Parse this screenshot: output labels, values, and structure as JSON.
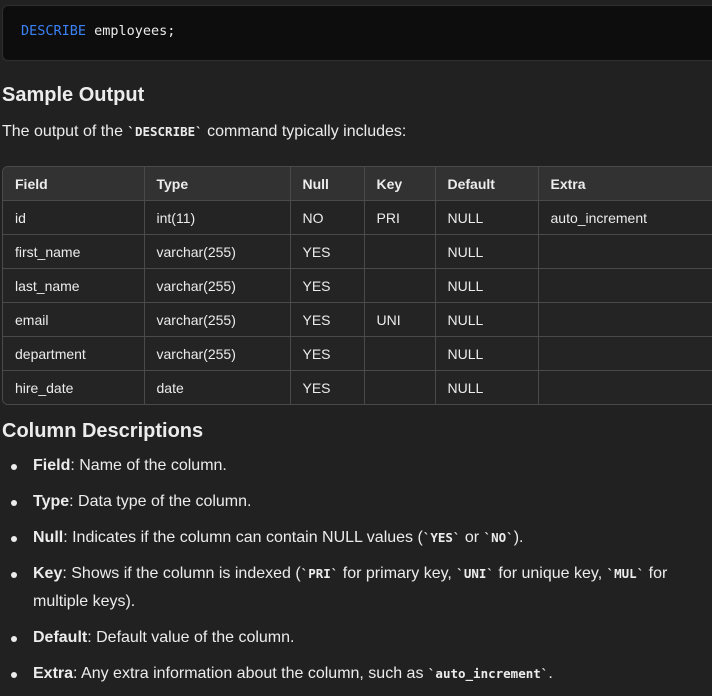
{
  "code": {
    "keyword": "DESCRIBE",
    "rest": " employees;"
  },
  "sample_output": {
    "heading": "Sample Output",
    "intro_before": "The output of the ",
    "intro_code": "`DESCRIBE`",
    "intro_after": " command typically includes:"
  },
  "table": {
    "headers": [
      "Field",
      "Type",
      "Null",
      "Key",
      "Default",
      "Extra"
    ],
    "rows": [
      [
        "id",
        "int(11)",
        "NO",
        "PRI",
        "NULL",
        "auto_increment"
      ],
      [
        "first_name",
        "varchar(255)",
        "YES",
        "",
        "NULL",
        ""
      ],
      [
        "last_name",
        "varchar(255)",
        "YES",
        "",
        "NULL",
        ""
      ],
      [
        "email",
        "varchar(255)",
        "YES",
        "UNI",
        "NULL",
        ""
      ],
      [
        "department",
        "varchar(255)",
        "YES",
        "",
        "NULL",
        ""
      ],
      [
        "hire_date",
        "date",
        "YES",
        "",
        "NULL",
        ""
      ]
    ]
  },
  "column_descriptions": {
    "heading": "Column Descriptions",
    "items": [
      {
        "term": "Field",
        "text": ": Name of the column."
      },
      {
        "term": "Type",
        "text": ": Data type of the column."
      },
      {
        "term": "Null",
        "text_before": ": Indicates if the column can contain NULL values (",
        "code1": "`YES`",
        "mid": " or ",
        "code2": "`NO`",
        "text_after": ")."
      },
      {
        "term": "Key",
        "text_before": ": Shows if the column is indexed (",
        "code1": "`PRI`",
        "mid1": " for primary key, ",
        "code2": "`UNI`",
        "mid2": " for unique key, ",
        "code3": "`MUL`",
        "text_after": " for multiple keys)."
      },
      {
        "term": "Default",
        "text": ": Default value of the column."
      },
      {
        "term": "Extra",
        "text_before": ": Any extra information about the column, such as ",
        "code1": "`auto_increment`",
        "text_after": "."
      }
    ]
  }
}
